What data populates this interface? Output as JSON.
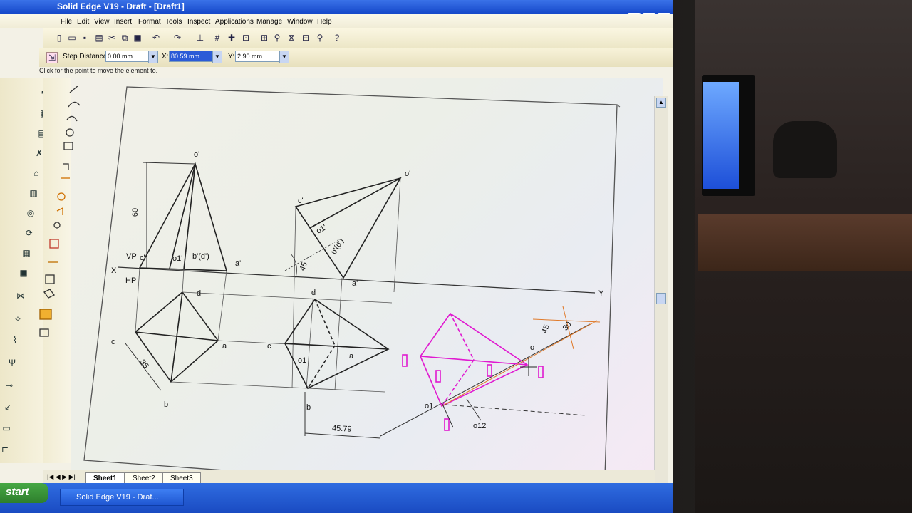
{
  "window": {
    "title": "Solid Edge V19 - Draft - [Draft1]",
    "buttons": {
      "minimize": "_",
      "restore": "❐",
      "close": "✕"
    }
  },
  "menu": [
    "File",
    "Edit",
    "View",
    "Insert",
    "Format",
    "Tools",
    "Inspect",
    "Applications",
    "Manage",
    "Window",
    "Help"
  ],
  "ribbon": {
    "step_label": "Step Distance:",
    "step_value": "0.00 mm",
    "x_label": "X:",
    "x_value": "80.59 mm",
    "y_label": "Y:",
    "y_value": "2.90 mm"
  },
  "prompt": "Click for the point to move the element to.",
  "sheets": [
    "Sheet1",
    "Sheet2",
    "Sheet3"
  ],
  "active_sheet": "Sheet1",
  "taskbar": {
    "start": "start",
    "item": "Solid Edge V19 - Draf..."
  },
  "drawing": {
    "top_apex": "o'",
    "vp": "VP",
    "hp": "HP",
    "x": "X",
    "y": "Y",
    "c_prime": "c'",
    "o1_prime": "o1'",
    "bd_prime": "b'(d')",
    "a_prime": "a'",
    "dim_60": "60",
    "d": "d",
    "a": "a",
    "c": "c",
    "b": "b",
    "dim_35": "35",
    "c2": "c",
    "d2": "d",
    "o1_2": "o1",
    "a2": "a",
    "b2": "b",
    "dim_4579": "45.79",
    "o_prime2": "o'",
    "c_prime2": "c'",
    "o1_prime2": "o1'",
    "bd_prime2": "b'(d')",
    "angle_45": "45",
    "a_prime2": "a'",
    "o_3": "o",
    "o1_3": "o1",
    "o12": "o12",
    "angle_45b": "45",
    "angle_30": "30"
  },
  "colors": {
    "titlebar": "#1446c8",
    "magenta": "#e01ad0",
    "orange": "#e07a2a"
  }
}
